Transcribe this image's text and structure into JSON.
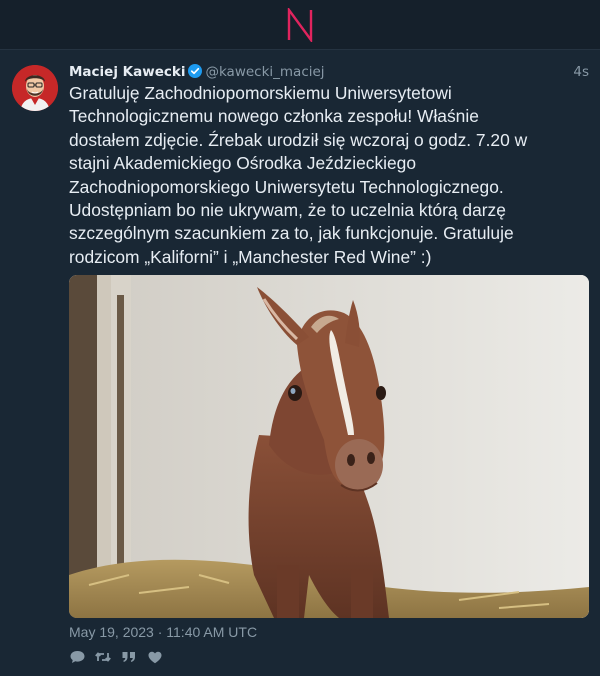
{
  "app": {
    "logo_icon": "n-logo-icon",
    "accent_color": "#e0245e"
  },
  "tweet": {
    "author": {
      "name": "Maciej Kawecki",
      "handle": "@kawecki_maciej",
      "verified": true,
      "avatar_icon": "avatar-illustration"
    },
    "time_ago": "4s",
    "text": "Gratuluję Zachodniopomorskiemu Uniwersytetowi Technologicznemu nowego członka zespołu! Właśnie dostałem zdjęcie. Źrebak urodził się wczoraj o godz. 7.20 w stajni Akademickiego Ośrodka Jeździeckiego Zachodniopomorskiego Uniwersytetu Technologicznego. Udostępniam bo nie ukrywam, że to uczelnia którą darzę szczególnym szacunkiem za to, jak funkcjonuje. Gratuluje rodzicom „Kaliforni” i „Manchester Red Wine” :)",
    "lines": [
      "Gratuluję Zachodniopomorskiemu Uniwersytetowi",
      "Technologicznemu nowego członka zespołu! Właśnie",
      "dostałem zdjęcie. Źrebak urodził się wczoraj o godz. 7.20 w",
      "stajni Akademickiego Ośrodka Jeździeckiego",
      "Zachodniopomorskiego Uniwersytetu Technologicznego.",
      "Udostępniam bo nie ukrywam, że to uczelnia którą darzę",
      "szczególnym szacunkiem za to, jak funkcjonuje. Gratuluje",
      "rodzicom „Kaliforni” i „Manchester Red Wine” :)"
    ],
    "media_icon": "foal-photo",
    "timestamp": "May 19, 2023 · 11:40 AM UTC",
    "actions": [
      {
        "name": "reply",
        "icon": "reply-icon"
      },
      {
        "name": "retweet",
        "icon": "retweet-icon"
      },
      {
        "name": "quote",
        "icon": "quote-icon"
      },
      {
        "name": "like",
        "icon": "heart-icon"
      }
    ]
  },
  "colors": {
    "background": "#15202b",
    "card": "#192734",
    "text": "#e7edf3",
    "muted": "#8899a6",
    "verified": "#1d9bf0"
  }
}
